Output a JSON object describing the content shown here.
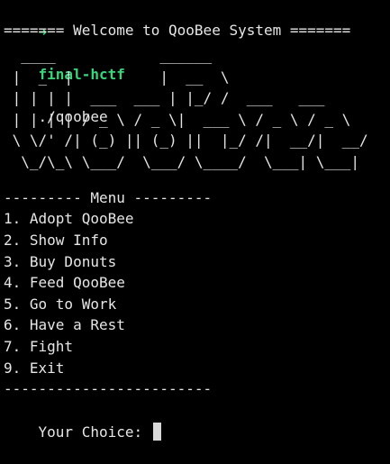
{
  "terminal": {
    "prompt": {
      "arrow": "➜",
      "directory": "final-hctf",
      "command": "./qoobee"
    },
    "welcome_banner": "======= Welcome to QooBee System =======",
    "ascii_art": "  ____            ______\n |  _  |          |  __  \\\n | | | |  ___  ___ | |_/ /  ___   ___\n | | | | / _ \\ / _ \\|  ___ \\ / _ \\ / _ \\\n \\ \\/' /| (_) || (_) ||  |_/ /|  __/|  __/\n  \\_/\\_\\ \\___/  \\___/ \\____/  \\___| \\___|",
    "menu": {
      "header": "--------- Menu ---------",
      "items": [
        "1. Adopt QooBee",
        "2. Show Info",
        "3. Buy Donuts",
        "4. Feed QooBee",
        "5. Go to Work",
        "6. Have a Rest",
        "7. Fight",
        "9. Exit"
      ],
      "footer": "------------------------"
    },
    "input_prompt": "Your Choice: ",
    "colors": {
      "background": "#000000",
      "foreground": "#e6e6e6",
      "prompt_green": "#37d67a",
      "cursor": "#d8d8d8"
    }
  }
}
